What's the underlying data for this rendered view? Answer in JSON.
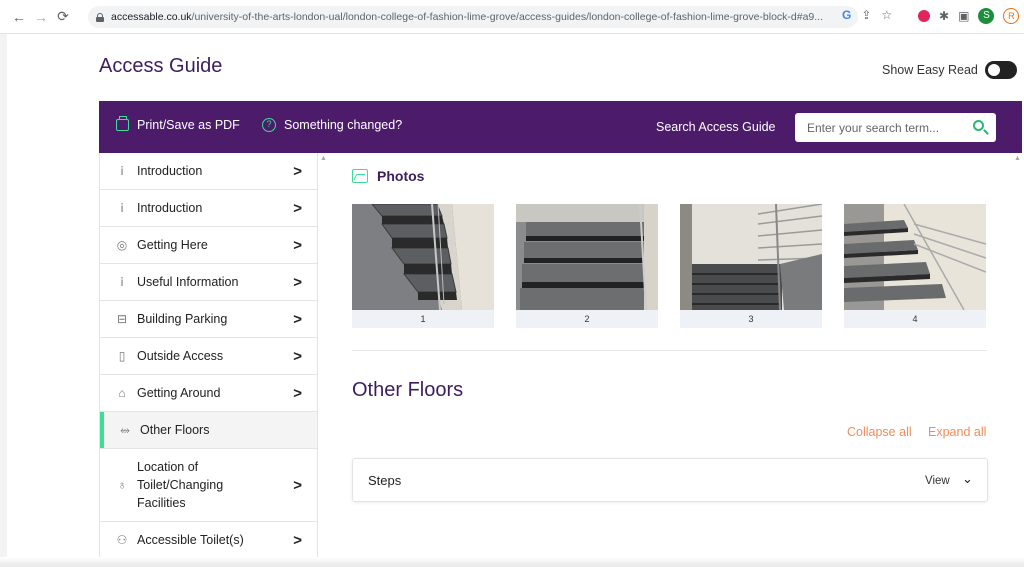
{
  "browser": {
    "url_host": "accessable.co.uk",
    "url_path": "/university-of-the-arts-london-ual/london-college-of-fashion-lime-grove/access-guides/london-college-of-fashion-lime-grove-block-d#a9...",
    "profile_initial": "S",
    "profile2_initial": "R"
  },
  "page": {
    "title": "Access Guide",
    "easy_read_label": "Show Easy Read"
  },
  "toolbar": {
    "print_label": "Print/Save as PDF",
    "changed_label": "Something changed?",
    "search_label": "Search Access Guide",
    "search_placeholder": "Enter your search term..."
  },
  "sidebar": {
    "items": [
      {
        "label": "Introduction",
        "icon": "info-icon"
      },
      {
        "label": "Introduction",
        "icon": "info-icon"
      },
      {
        "label": "Getting Here",
        "icon": "location-pin-icon"
      },
      {
        "label": "Useful Information",
        "icon": "info-icon"
      },
      {
        "label": "Building Parking",
        "icon": "car-icon"
      },
      {
        "label": "Outside Access",
        "icon": "door-icon"
      },
      {
        "label": "Getting Around",
        "icon": "building-icon"
      },
      {
        "label": "Other Floors",
        "icon": "stairs-icon"
      },
      {
        "label": "Location of Toilet/Changing Facilities",
        "icon": "toilet-icon"
      },
      {
        "label": "Accessible Toilet(s)",
        "icon": "accessible-toilet-icon"
      }
    ]
  },
  "photos": {
    "heading": "Photos",
    "items": [
      {
        "caption": "1"
      },
      {
        "caption": "2"
      },
      {
        "caption": "3"
      },
      {
        "caption": "4"
      }
    ]
  },
  "other_floors": {
    "title": "Other Floors",
    "collapse_label": "Collapse all",
    "expand_label": "Expand all",
    "accordion": {
      "title": "Steps",
      "view_label": "View"
    }
  },
  "colors": {
    "purple": "#4c1c6b",
    "accent_green": "#3ddc97",
    "link_orange": "#f08c5a"
  }
}
